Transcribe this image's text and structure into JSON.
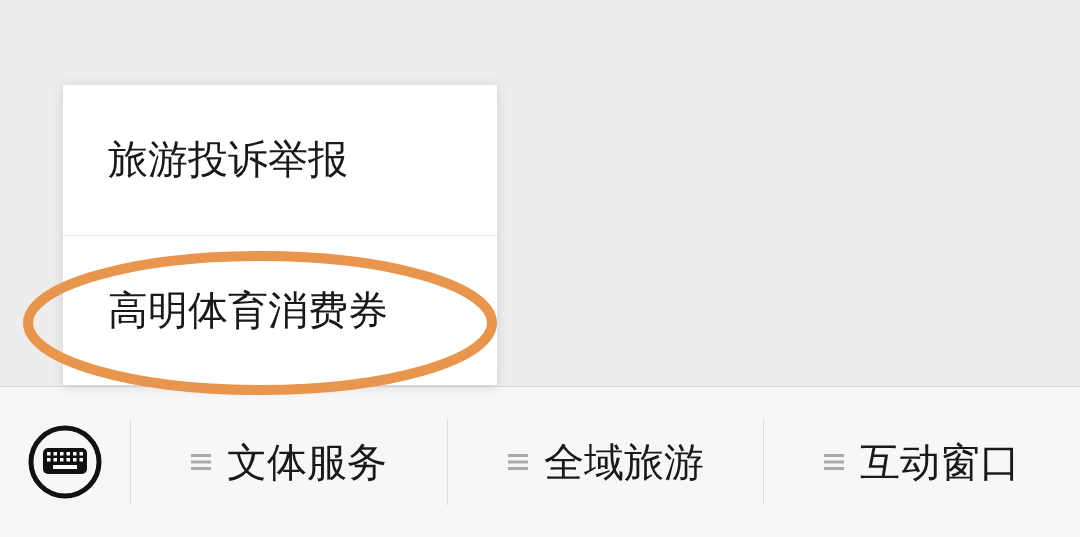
{
  "popup_menu": {
    "items": [
      {
        "label": "旅游投诉举报"
      },
      {
        "label": "高明体育消费券",
        "highlighted": true
      }
    ]
  },
  "bottom_menu": {
    "items": [
      {
        "label": "文体服务"
      },
      {
        "label": "全域旅游"
      },
      {
        "label": "互动窗口"
      }
    ]
  }
}
